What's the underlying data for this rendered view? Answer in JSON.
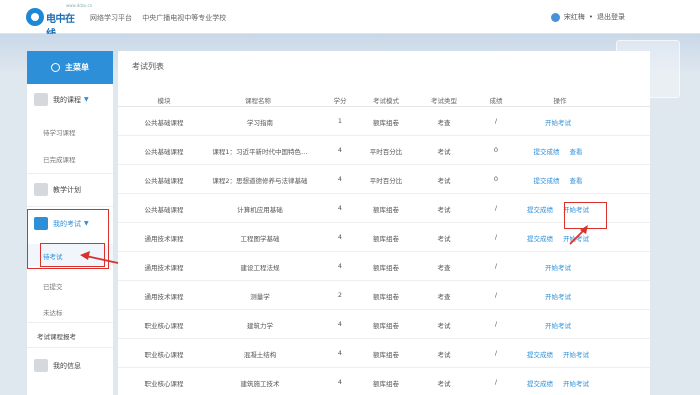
{
  "header": {
    "logo_text": "电中在线",
    "logo_sub": "www.ddzx.cn",
    "links": [
      "网络学习平台",
      "中央广播电视中等专业学校"
    ],
    "user_name": "宋红梅",
    "logout_label": "退出登录"
  },
  "sidebar": {
    "menu_title": "主菜单",
    "my_courses": "我的课程",
    "course_subs": [
      "待学习课程",
      "已完成课程"
    ],
    "teaching_plan": "教学计划",
    "my_exams": "我的考试",
    "exam_subs": [
      "待考试",
      "已提交",
      "未达标"
    ],
    "exam_signup": "考试课程报考",
    "my_info": "我的信息"
  },
  "main": {
    "title": "考试列表",
    "columns": [
      "模块",
      "课程名称",
      "学分",
      "考试模式",
      "考试类型",
      "成绩",
      "操作"
    ],
    "rows": [
      {
        "module": "公共基础课程",
        "course": "学习指南",
        "credit": "1",
        "mode": "额库组卷",
        "type": "考查",
        "score": "/",
        "ops": [
          "开始考试"
        ]
      },
      {
        "module": "公共基础课程",
        "course": "课程1：习近平新时代中国特色…",
        "credit": "4",
        "mode": "平时百分比",
        "type": "考试",
        "score": "0",
        "ops": [
          "提交成绩",
          "查看"
        ]
      },
      {
        "module": "公共基础课程",
        "course": "课程2：思想道德修养与法律基础",
        "credit": "4",
        "mode": "平时百分比",
        "type": "考试",
        "score": "0",
        "ops": [
          "提交成绩",
          "查看"
        ]
      },
      {
        "module": "公共基础课程",
        "course": "计算机应用基础",
        "credit": "4",
        "mode": "额库组卷",
        "type": "考试",
        "score": "/",
        "ops": [
          "提交成绩",
          "开始考试"
        ]
      },
      {
        "module": "通用技术课程",
        "course": "工程图学基础",
        "credit": "4",
        "mode": "额库组卷",
        "type": "考试",
        "score": "/",
        "ops": [
          "提交成绩",
          "开始考试"
        ]
      },
      {
        "module": "通用技术课程",
        "course": "建设工程法规",
        "credit": "4",
        "mode": "额库组卷",
        "type": "考查",
        "score": "/",
        "ops": [
          "开始考试"
        ]
      },
      {
        "module": "通用技术课程",
        "course": "测量学",
        "credit": "2",
        "mode": "额库组卷",
        "type": "考查",
        "score": "/",
        "ops": [
          "开始考试"
        ]
      },
      {
        "module": "职业核心课程",
        "course": "建筑力学",
        "credit": "4",
        "mode": "额库组卷",
        "type": "考试",
        "score": "/",
        "ops": [
          "开始考试"
        ]
      },
      {
        "module": "职业核心课程",
        "course": "混凝土结构",
        "credit": "4",
        "mode": "额库组卷",
        "type": "考试",
        "score": "/",
        "ops": [
          "提交成绩",
          "开始考试"
        ]
      },
      {
        "module": "职业核心课程",
        "course": "建筑施工技术",
        "credit": "4",
        "mode": "额库组卷",
        "type": "考试",
        "score": "/",
        "ops": [
          "提交成绩",
          "开始考试"
        ]
      }
    ]
  },
  "colors": {
    "accent": "#2d8fd8",
    "highlight_red": "#d9312b"
  }
}
